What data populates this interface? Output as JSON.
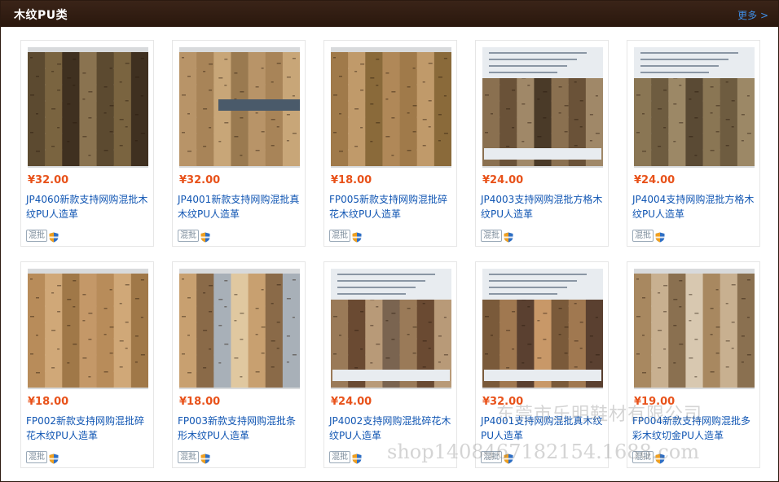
{
  "header": {
    "title": "木纹PU类",
    "more_label": "更多 >"
  },
  "colors": {
    "header_bg": "#2a170d",
    "price": "#e8521a",
    "link": "#1156b3"
  },
  "tag_label": "混批",
  "products": [
    {
      "price": "¥32.00",
      "title": "JP4060新款支持网购混批木纹PU人造革"
    },
    {
      "price": "¥32.00",
      "title": "JP4001新款支持网购混批真木纹PU人造革"
    },
    {
      "price": "¥18.00",
      "title": "FP005新款支持网购混批碎花木纹PU人造革"
    },
    {
      "price": "¥24.00",
      "title": "JP4003支持网购混批方格木纹PU人造革"
    },
    {
      "price": "¥24.00",
      "title": "JP4004支持网购混批方格木纹PU人造革"
    },
    {
      "price": "¥18.00",
      "title": "FP002新款支持网购混批碎花木纹PU人造革"
    },
    {
      "price": "¥18.00",
      "title": "FP003新款支持网购混批条形木纹PU人造革"
    },
    {
      "price": "¥24.00",
      "title": "JP4002支持网购混批碎花木纹PU人造革"
    },
    {
      "price": "¥32.00",
      "title": "JP4001支持网购混批真木纹PU人造革"
    },
    {
      "price": "¥19.00",
      "title": "FP004新款支持网购混批多彩木纹切金PU人造革"
    }
  ],
  "watermark": {
    "line1": "东莞市乐明鞋材有限公司",
    "line2": "shop1408467182154.1688.com"
  }
}
